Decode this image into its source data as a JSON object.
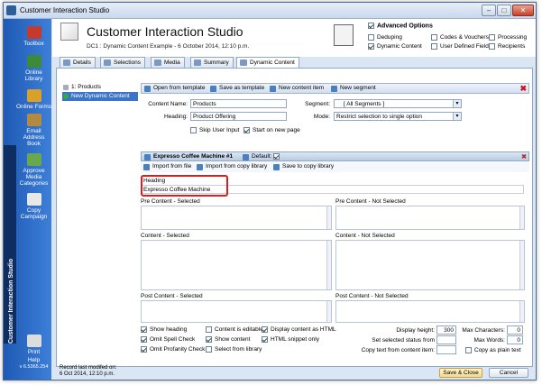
{
  "window": {
    "title": "Customer Interaction Studio",
    "min": "–",
    "max": "□",
    "close": "✕"
  },
  "sidebar": {
    "brand": "Customer Interaction Studio",
    "items": [
      {
        "label": "Toolbox",
        "color": "#c43b2d"
      },
      {
        "label": "Online Library",
        "color": "#3c8a3a"
      },
      {
        "label": "Online Forms",
        "color": "#d9a12a"
      },
      {
        "label": "Email Address Book",
        "color": "#b48a43"
      },
      {
        "label": "Approve Media Categories",
        "color": "#6aa84f"
      },
      {
        "label": "Copy Campaign",
        "color": "#e8e8e8"
      }
    ],
    "print": "Print",
    "help": "Help",
    "version": "v 6.5365.254"
  },
  "header": {
    "title": "Customer Interaction Studio",
    "subtitle": "DC1 : Dynamic Content Example - 6 October 2014, 12:10 p.m."
  },
  "advanced": {
    "title": "Advanced Options",
    "options": [
      {
        "label": "Deduping",
        "checked": false
      },
      {
        "label": "Codes & Vouchers",
        "checked": false
      },
      {
        "label": "Processing",
        "checked": false
      },
      {
        "label": "Dynamic Content",
        "checked": true
      },
      {
        "label": "User Defined Fields",
        "checked": false
      },
      {
        "label": "Recipients",
        "checked": false
      }
    ]
  },
  "tabs": [
    {
      "label": "Details"
    },
    {
      "label": "Selections"
    },
    {
      "label": "Media"
    },
    {
      "label": "Summary"
    },
    {
      "label": "Dynamic Content"
    }
  ],
  "tree": {
    "items": [
      {
        "label": "1: Products"
      },
      {
        "label": "New Dynamic Content"
      }
    ]
  },
  "toolbar": {
    "open_template": "Open from template",
    "save_template": "Save as template",
    "new_item": "New content item",
    "new_segment": "New segment"
  },
  "form": {
    "content_name_label": "Content Name:",
    "content_name": "Products",
    "heading_label": "Heading:",
    "heading": "Product Offering",
    "segment_label": "Segment:",
    "segment": "[ All Segments ]",
    "mode_label": "Mode:",
    "mode": "Restrict selection to single option",
    "skip_label": "Skip User Input",
    "start_label": "Start on new page"
  },
  "item": {
    "title": "Expresso Coffee Machine #1",
    "default_label": "Default:",
    "import_file": "Import from file",
    "import_library": "Import from copy library",
    "save_library": "Save to copy library",
    "heading_label": "Heading",
    "heading_value": "Expresso Coffee Machine"
  },
  "panels": {
    "pre_selected": "Pre Content - Selected",
    "pre_not": "Pre Content - Not Selected",
    "content_selected": "Content - Selected",
    "content_not": "Content - Not Selected",
    "post_selected": "Post Content - Selected",
    "post_not": "Post Content - Not Selected"
  },
  "options": {
    "show_heading": "Show heading",
    "omit_spell": "Omit Spell Check",
    "omit_profanity": "Omit Profanity Check",
    "editable": "Content is editable",
    "show_content": "Show content",
    "select_library": "Select from library",
    "display_html": "Display content as HTML",
    "html_snippet": "HTML snippet only",
    "display_height_label": "Display height:",
    "display_height": "300",
    "set_selected_label": "Set selected status from",
    "copy_text_label": "Copy text from content item:",
    "max_chars_label": "Max Characters:",
    "max_chars": "0",
    "max_words_label": "Max Words:",
    "max_words": "0",
    "copy_plain": "Copy as plain text"
  },
  "status": {
    "line1": "Record last modifed on:",
    "line2": "6 Oct 2014, 12:10 p.m."
  },
  "buttons": {
    "save_close": "Save & Close",
    "cancel": "Cancel"
  }
}
